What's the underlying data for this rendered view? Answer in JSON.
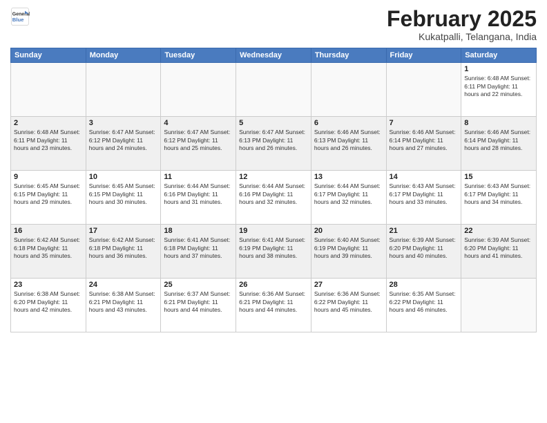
{
  "logo": {
    "line1": "General",
    "line2": "Blue"
  },
  "title": "February 2025",
  "subtitle": "Kukatpalli, Telangana, India",
  "days_of_week": [
    "Sunday",
    "Monday",
    "Tuesday",
    "Wednesday",
    "Thursday",
    "Friday",
    "Saturday"
  ],
  "weeks": [
    [
      {
        "day": "",
        "info": ""
      },
      {
        "day": "",
        "info": ""
      },
      {
        "day": "",
        "info": ""
      },
      {
        "day": "",
        "info": ""
      },
      {
        "day": "",
        "info": ""
      },
      {
        "day": "",
        "info": ""
      },
      {
        "day": "1",
        "info": "Sunrise: 6:48 AM\nSunset: 6:11 PM\nDaylight: 11 hours and 22 minutes."
      }
    ],
    [
      {
        "day": "2",
        "info": "Sunrise: 6:48 AM\nSunset: 6:11 PM\nDaylight: 11 hours and 23 minutes."
      },
      {
        "day": "3",
        "info": "Sunrise: 6:47 AM\nSunset: 6:12 PM\nDaylight: 11 hours and 24 minutes."
      },
      {
        "day": "4",
        "info": "Sunrise: 6:47 AM\nSunset: 6:12 PM\nDaylight: 11 hours and 25 minutes."
      },
      {
        "day": "5",
        "info": "Sunrise: 6:47 AM\nSunset: 6:13 PM\nDaylight: 11 hours and 26 minutes."
      },
      {
        "day": "6",
        "info": "Sunrise: 6:46 AM\nSunset: 6:13 PM\nDaylight: 11 hours and 26 minutes."
      },
      {
        "day": "7",
        "info": "Sunrise: 6:46 AM\nSunset: 6:14 PM\nDaylight: 11 hours and 27 minutes."
      },
      {
        "day": "8",
        "info": "Sunrise: 6:46 AM\nSunset: 6:14 PM\nDaylight: 11 hours and 28 minutes."
      }
    ],
    [
      {
        "day": "9",
        "info": "Sunrise: 6:45 AM\nSunset: 6:15 PM\nDaylight: 11 hours and 29 minutes."
      },
      {
        "day": "10",
        "info": "Sunrise: 6:45 AM\nSunset: 6:15 PM\nDaylight: 11 hours and 30 minutes."
      },
      {
        "day": "11",
        "info": "Sunrise: 6:44 AM\nSunset: 6:16 PM\nDaylight: 11 hours and 31 minutes."
      },
      {
        "day": "12",
        "info": "Sunrise: 6:44 AM\nSunset: 6:16 PM\nDaylight: 11 hours and 32 minutes."
      },
      {
        "day": "13",
        "info": "Sunrise: 6:44 AM\nSunset: 6:17 PM\nDaylight: 11 hours and 32 minutes."
      },
      {
        "day": "14",
        "info": "Sunrise: 6:43 AM\nSunset: 6:17 PM\nDaylight: 11 hours and 33 minutes."
      },
      {
        "day": "15",
        "info": "Sunrise: 6:43 AM\nSunset: 6:17 PM\nDaylight: 11 hours and 34 minutes."
      }
    ],
    [
      {
        "day": "16",
        "info": "Sunrise: 6:42 AM\nSunset: 6:18 PM\nDaylight: 11 hours and 35 minutes."
      },
      {
        "day": "17",
        "info": "Sunrise: 6:42 AM\nSunset: 6:18 PM\nDaylight: 11 hours and 36 minutes."
      },
      {
        "day": "18",
        "info": "Sunrise: 6:41 AM\nSunset: 6:18 PM\nDaylight: 11 hours and 37 minutes."
      },
      {
        "day": "19",
        "info": "Sunrise: 6:41 AM\nSunset: 6:19 PM\nDaylight: 11 hours and 38 minutes."
      },
      {
        "day": "20",
        "info": "Sunrise: 6:40 AM\nSunset: 6:19 PM\nDaylight: 11 hours and 39 minutes."
      },
      {
        "day": "21",
        "info": "Sunrise: 6:39 AM\nSunset: 6:20 PM\nDaylight: 11 hours and 40 minutes."
      },
      {
        "day": "22",
        "info": "Sunrise: 6:39 AM\nSunset: 6:20 PM\nDaylight: 11 hours and 41 minutes."
      }
    ],
    [
      {
        "day": "23",
        "info": "Sunrise: 6:38 AM\nSunset: 6:20 PM\nDaylight: 11 hours and 42 minutes."
      },
      {
        "day": "24",
        "info": "Sunrise: 6:38 AM\nSunset: 6:21 PM\nDaylight: 11 hours and 43 minutes."
      },
      {
        "day": "25",
        "info": "Sunrise: 6:37 AM\nSunset: 6:21 PM\nDaylight: 11 hours and 44 minutes."
      },
      {
        "day": "26",
        "info": "Sunrise: 6:36 AM\nSunset: 6:21 PM\nDaylight: 11 hours and 44 minutes."
      },
      {
        "day": "27",
        "info": "Sunrise: 6:36 AM\nSunset: 6:22 PM\nDaylight: 11 hours and 45 minutes."
      },
      {
        "day": "28",
        "info": "Sunrise: 6:35 AM\nSunset: 6:22 PM\nDaylight: 11 hours and 46 minutes."
      },
      {
        "day": "",
        "info": ""
      }
    ]
  ]
}
